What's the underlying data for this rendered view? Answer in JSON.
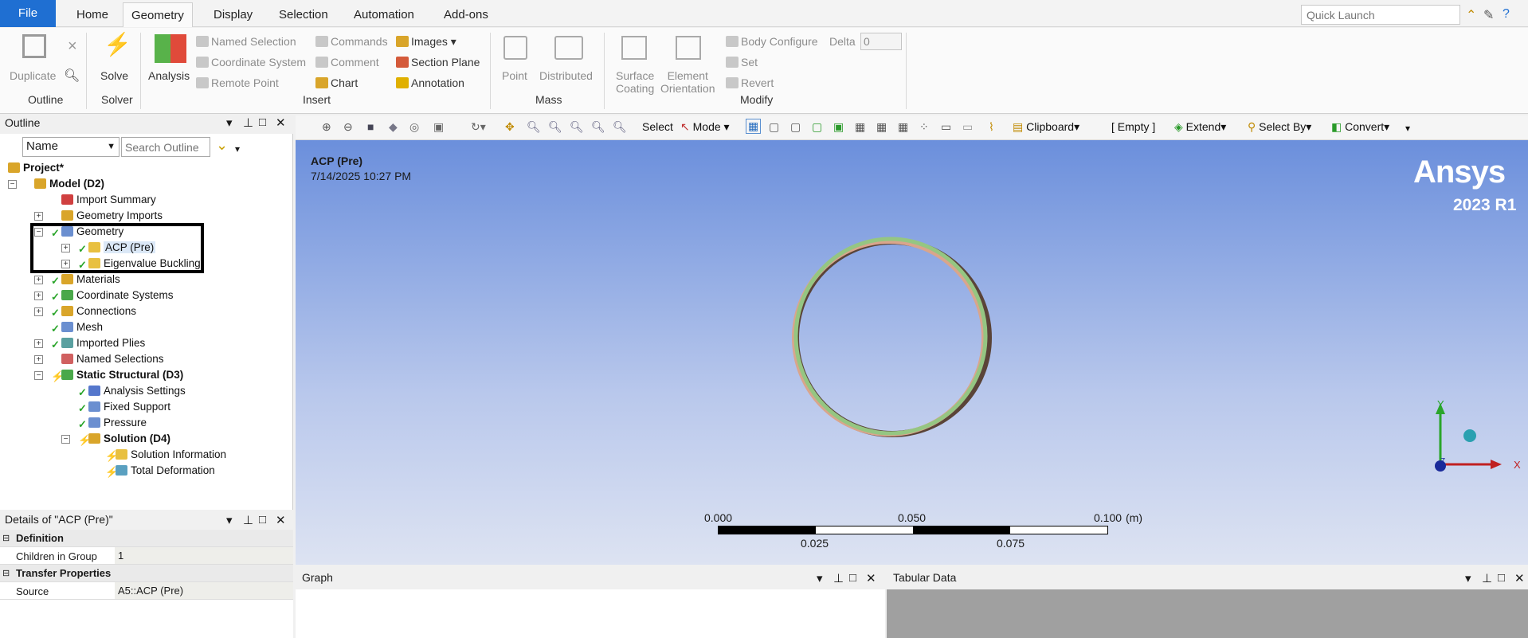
{
  "tabs": {
    "file": "File",
    "home": "Home",
    "geometry": "Geometry",
    "display": "Display",
    "selection": "Selection",
    "automation": "Automation",
    "addons": "Add-ons"
  },
  "quick_launch_placeholder": "Quick Launch",
  "ribbon": {
    "duplicate": "Duplicate",
    "outline_group": "Outline",
    "solve": "Solve",
    "solver_group": "Solver",
    "analysis": "Analysis",
    "named_selection": "Named Selection",
    "coordinate_system": "Coordinate System",
    "remote_point": "Remote Point",
    "commands": "Commands",
    "comment": "Comment",
    "chart": "Chart",
    "images": "Images",
    "section_plane": "Section Plane",
    "annotation": "Annotation",
    "insert_group": "Insert",
    "point": "Point",
    "distributed": "Distributed",
    "mass_group": "Mass",
    "surface": "Surface",
    "coating": "Coating",
    "element": "Element",
    "orientation": "Orientation",
    "body_configure": "Body Configure",
    "delta": "Delta",
    "delta_value": "0",
    "set": "Set",
    "revert": "Revert",
    "modify_group": "Modify"
  },
  "outline": {
    "title": "Outline",
    "filter_value": "Name",
    "search_placeholder": "Search Outline",
    "items": {
      "project": "Project*",
      "model": "Model (D2)",
      "import_summary": "Import Summary",
      "geometry_imports": "Geometry Imports",
      "geometry": "Geometry",
      "acp_pre": "ACP (Pre)",
      "eigen": "Eigenvalue Buckling",
      "materials": "Materials",
      "coord_systems": "Coordinate Systems",
      "connections": "Connections",
      "mesh": "Mesh",
      "imported_plies": "Imported Plies",
      "named_selections": "Named Selections",
      "static": "Static Structural (D3)",
      "analysis_settings": "Analysis Settings",
      "fixed_support": "Fixed Support",
      "pressure": "Pressure",
      "solution": "Solution (D4)",
      "solution_info": "Solution Information",
      "total_def": "Total Deformation"
    }
  },
  "graphics_toolbar": {
    "select": "Select",
    "mode": "Mode",
    "clipboard": "Clipboard",
    "empty": "[ Empty ]",
    "extend": "Extend",
    "select_by": "Select By",
    "convert": "Convert"
  },
  "viewport": {
    "title": "ACP (Pre)",
    "date": "7/14/2025 10:27 PM",
    "brand": "Ansys",
    "version": "2023 R1",
    "scale": {
      "s0": "0.000",
      "s1": "0.025",
      "s2": "0.050",
      "s3": "0.075",
      "s4": "0.100",
      "unit": "(m)"
    },
    "axis_x": "X",
    "axis_y": "Y",
    "axis_z": "Z"
  },
  "details": {
    "title": "Details of \"ACP (Pre)\"",
    "definition": "Definition",
    "children_label": "Children in Group",
    "children_value": "1",
    "transfer": "Transfer Properties",
    "source_label": "Source",
    "source_value": "A5::ACP (Pre)"
  },
  "graph_title": "Graph",
  "tabular_title": "Tabular Data"
}
